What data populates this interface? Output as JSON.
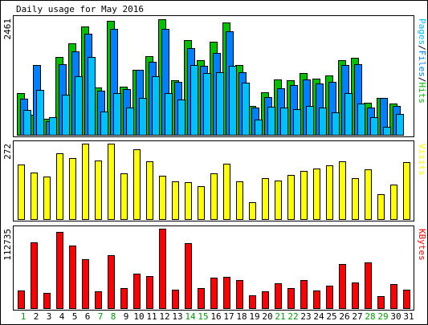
{
  "chart_data": [
    {
      "type": "bar",
      "title": "Daily usage for May 2016",
      "ylabel_max": "2461",
      "legend": [
        {
          "text": "Pages",
          "color": "#00c0ff"
        },
        {
          "text": "/",
          "color": "#000000"
        },
        {
          "text": "Files",
          "color": "#0080ff"
        },
        {
          "text": "/",
          "color": "#000000"
        },
        {
          "text": "Hits",
          "color": "#00c000"
        }
      ],
      "ylim": [
        0,
        2461
      ],
      "series": [
        {
          "name": "Hits",
          "color": "#00c000",
          "values": [
            891,
            418,
            346,
            1639,
            1941,
            2285,
            1002,
            2414,
            1011,
            1375,
            1664,
            2438,
            1157,
            2009,
            1586,
            1964,
            2377,
            1484,
            618,
            903,
            1163,
            1151,
            1305,
            1194,
            1249,
            1574,
            1626,
            679,
            789,
            658,
            0
          ]
        },
        {
          "name": "Files",
          "color": "#0080ff",
          "values": [
            759,
            1479,
            291,
            1492,
            1772,
            2132,
            931,
            2236,
            968,
            1382,
            1537,
            2240,
            1116,
            1840,
            1464,
            1723,
            2183,
            1331,
            574,
            790,
            989,
            1054,
            1178,
            1090,
            1121,
            1474,
            1495,
            581,
            789,
            618,
            0
          ]
        },
        {
          "name": "Pages",
          "color": "#00c0ff",
          "values": [
            520,
            942,
            368,
            852,
            1233,
            1639,
            500,
            880,
            581,
            780,
            1233,
            880,
            740,
            1472,
            1300,
            1322,
            1452,
            1110,
            323,
            600,
            579,
            550,
            612,
            580,
            470,
            880,
            670,
            378,
            177,
            435,
            0
          ]
        }
      ]
    },
    {
      "type": "bar",
      "ylabel_max": "272",
      "legend": [
        {
          "text": "Visits",
          "color": "#ffff00"
        }
      ],
      "ylim": [
        0,
        272
      ],
      "series": [
        {
          "name": "Visits",
          "color": "#ffff00",
          "values": [
            197,
            169,
            152,
            238,
            220,
            272,
            212,
            272,
            164,
            253,
            209,
            156,
            135,
            132,
            119,
            164,
            199,
            136,
            60,
            147,
            140,
            159,
            175,
            181,
            193,
            207,
            147,
            179,
            89,
            123,
            206
          ]
        }
      ]
    },
    {
      "type": "bar",
      "ylabel_max": "112735",
      "legend": [
        {
          "text": "KBytes",
          "color": "#ff0000"
        }
      ],
      "ylim": [
        0,
        112735
      ],
      "series": [
        {
          "name": "KBytes",
          "color": "#ff0000",
          "values": [
            24780,
            93430,
            21770,
            108200,
            88690,
            69790,
            23460,
            74910,
            28370,
            48410,
            45490,
            112735,
            25800,
            92420,
            28370,
            43560,
            44470,
            40330,
            18360,
            23460,
            35130,
            28370,
            40100,
            24930,
            31690,
            62330,
            36330,
            65030,
            16770,
            34470,
            26560
          ]
        }
      ]
    }
  ],
  "day_labels": [
    "1",
    "2",
    "3",
    "4",
    "5",
    "6",
    "7",
    "8",
    "9",
    "10",
    "11",
    "12",
    "13",
    "14",
    "15",
    "16",
    "17",
    "18",
    "19",
    "20",
    "21",
    "22",
    "23",
    "24",
    "25",
    "26",
    "27",
    "28",
    "29",
    "30",
    "31"
  ],
  "day_label_colors": {
    "weekday": "#000000",
    "weekend": "#00a000"
  },
  "weekend_days": [
    1,
    7,
    8,
    14,
    15,
    21,
    22,
    28,
    29
  ]
}
